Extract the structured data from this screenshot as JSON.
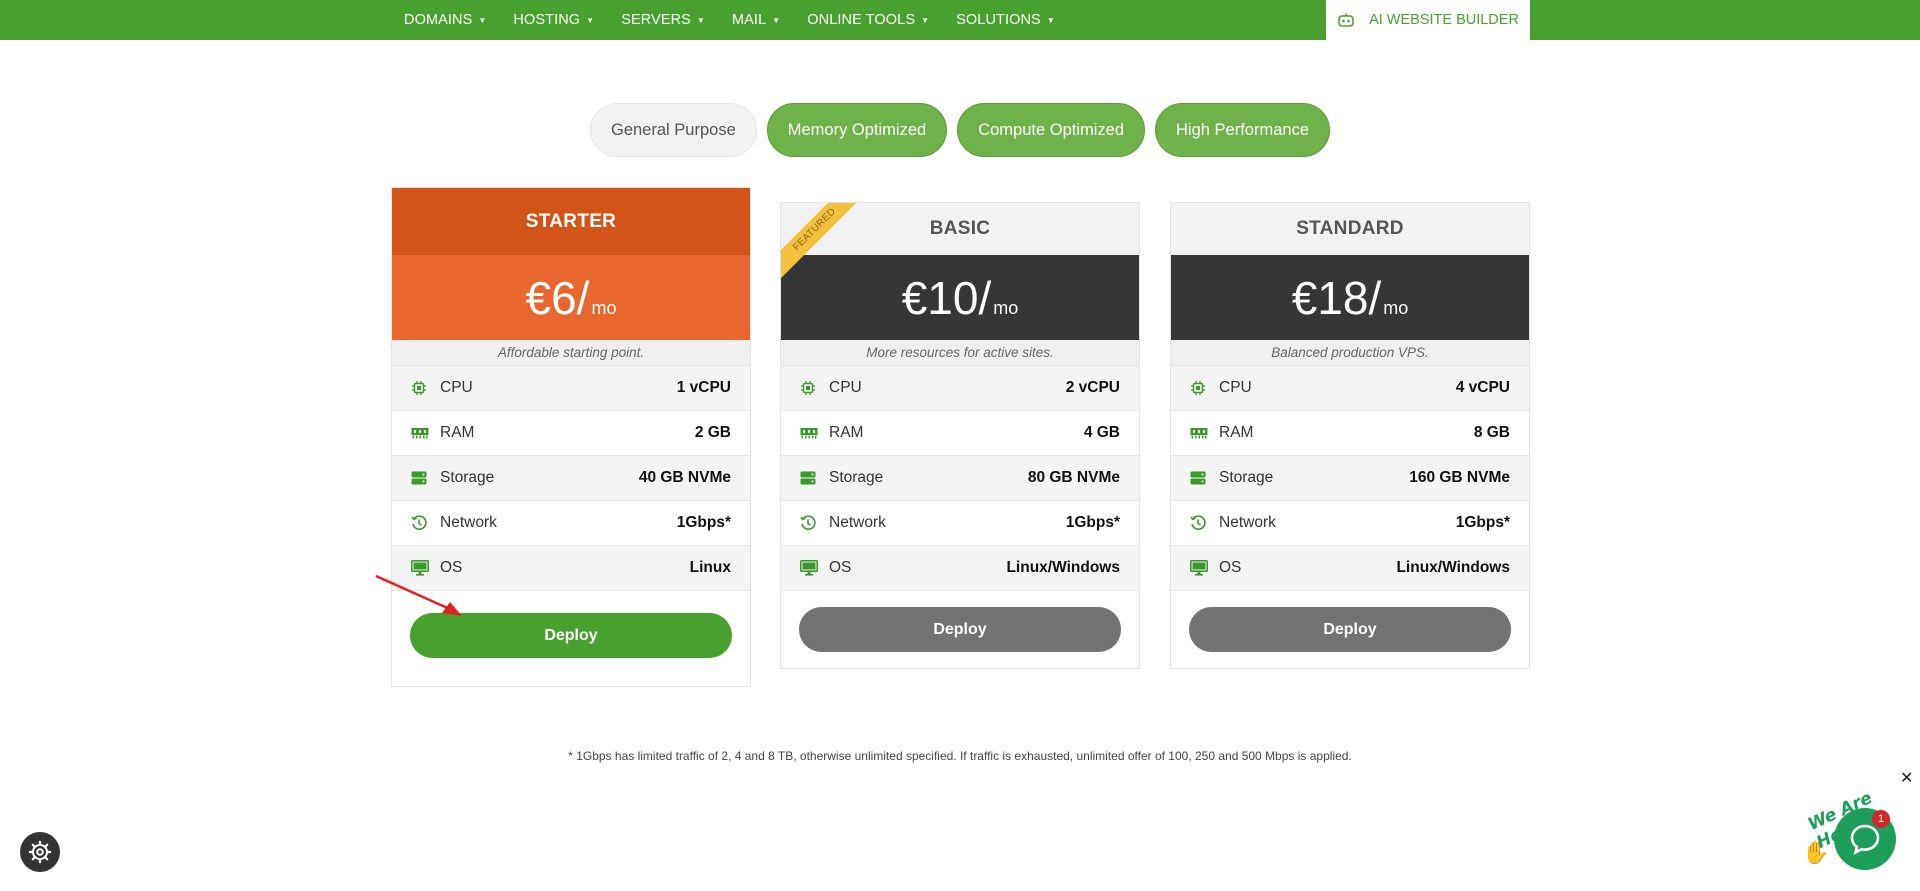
{
  "nav": {
    "items": [
      "DOMAINS",
      "HOSTING",
      "SERVERS",
      "MAIL",
      "ONLINE TOOLS",
      "SOLUTIONS"
    ],
    "builder_label": "AI WEBSITE BUILDER"
  },
  "categories": [
    {
      "label": "General Purpose",
      "state": "inactive"
    },
    {
      "label": "Memory Optimized",
      "state": "active"
    },
    {
      "label": "Compute Optimized",
      "state": "active"
    },
    {
      "label": "High Performance",
      "state": "active"
    }
  ],
  "plans": [
    {
      "name": "STARTER",
      "price": "€6/",
      "period": "mo",
      "tagline": "Affordable starting point.",
      "features": [
        {
          "label": "CPU",
          "value": "1 vCPU",
          "icon": "cpu-icon"
        },
        {
          "label": "RAM",
          "value": "2 GB",
          "icon": "ram-icon"
        },
        {
          "label": "Storage",
          "value": "40 GB NVMe",
          "icon": "storage-icon"
        },
        {
          "label": "Network",
          "value": "1Gbps*",
          "icon": "network-icon"
        },
        {
          "label": "OS",
          "value": "Linux",
          "icon": "monitor-icon"
        }
      ],
      "button": "Deploy"
    },
    {
      "name": "BASIC",
      "price": "€10/",
      "period": "mo",
      "tagline": "More resources for active sites.",
      "ribbon": "FEATURED",
      "features": [
        {
          "label": "CPU",
          "value": "2 vCPU",
          "icon": "cpu-icon"
        },
        {
          "label": "RAM",
          "value": "4 GB",
          "icon": "ram-icon"
        },
        {
          "label": "Storage",
          "value": "80 GB NVMe",
          "icon": "storage-icon"
        },
        {
          "label": "Network",
          "value": "1Gbps*",
          "icon": "network-icon"
        },
        {
          "label": "OS",
          "value": "Linux/Windows",
          "icon": "monitor-icon"
        }
      ],
      "button": "Deploy"
    },
    {
      "name": "STANDARD",
      "price": "€18/",
      "period": "mo",
      "tagline": "Balanced production VPS.",
      "features": [
        {
          "label": "CPU",
          "value": "4 vCPU",
          "icon": "cpu-icon"
        },
        {
          "label": "RAM",
          "value": "8 GB",
          "icon": "ram-icon"
        },
        {
          "label": "Storage",
          "value": "160 GB NVMe",
          "icon": "storage-icon"
        },
        {
          "label": "Network",
          "value": "1Gbps*",
          "icon": "network-icon"
        },
        {
          "label": "OS",
          "value": "Linux/Windows",
          "icon": "monitor-icon"
        }
      ],
      "button": "Deploy"
    }
  ],
  "footnote": "* 1Gbps has limited traffic of 2, 4 and 8 TB, otherwise unlimited specified. If traffic is exhausted, unlimited offer of 100, 250 and 500 Mbps is applied.",
  "chat": {
    "tagline": "We Are Here!",
    "badge": "1",
    "close": "✕"
  },
  "colors": {
    "brand_green": "#48a12e",
    "starter_orange": "#e8672e",
    "dark_price": "#363636"
  }
}
